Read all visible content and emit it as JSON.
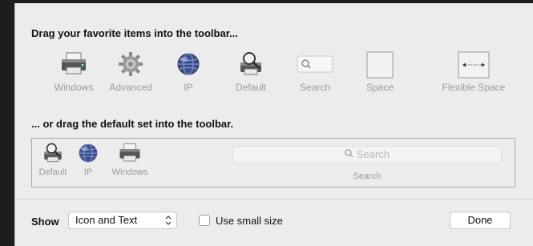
{
  "palette": {
    "heading": "Drag your favorite items into the toolbar...",
    "items": [
      {
        "label": "Windows",
        "icon": "printer-icon"
      },
      {
        "label": "Advanced",
        "icon": "gear-icon"
      },
      {
        "label": "IP",
        "icon": "globe-icon"
      },
      {
        "label": "Default",
        "icon": "printer-magnifier-icon"
      },
      {
        "label": "Search",
        "icon": "search-field-icon"
      },
      {
        "label": "Space",
        "icon": "space-icon"
      },
      {
        "label": "Flexible Space",
        "icon": "flexible-space-icon"
      }
    ]
  },
  "default_set": {
    "heading": "... or drag the default set into the toolbar.",
    "items": [
      {
        "label": "Default",
        "icon": "printer-magnifier-icon"
      },
      {
        "label": "IP",
        "icon": "globe-icon"
      },
      {
        "label": "Windows",
        "icon": "printer-icon"
      }
    ],
    "search_placeholder": "Search",
    "search_label": "Search"
  },
  "footer": {
    "show_label": "Show",
    "show_value": "Icon and Text",
    "small_size_label": "Use small size",
    "small_size_checked": false,
    "done_label": "Done"
  }
}
